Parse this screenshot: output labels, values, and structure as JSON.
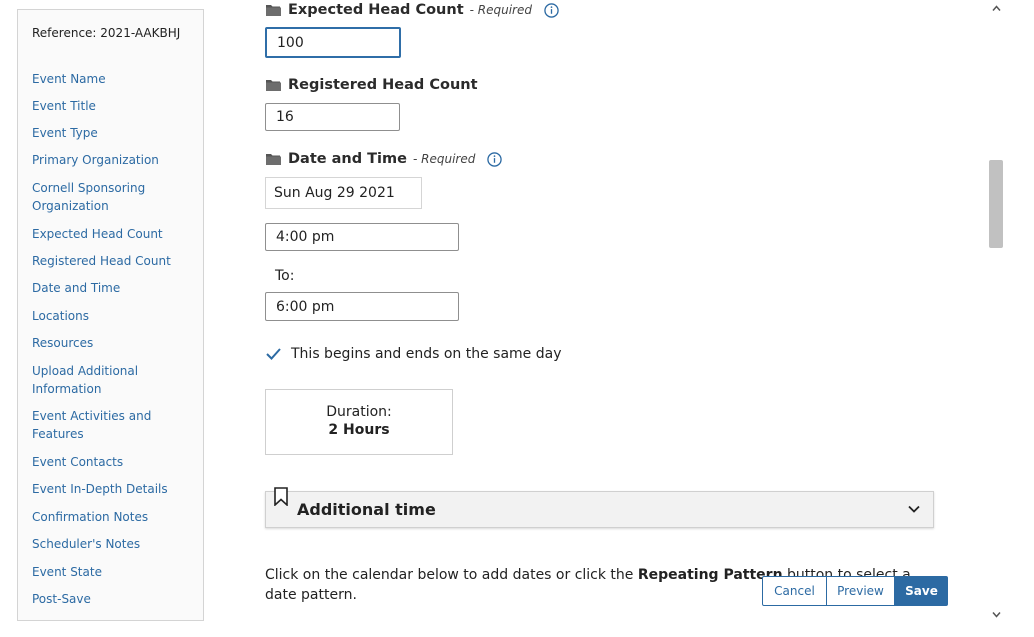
{
  "sidebar": {
    "reference": "Reference: 2021-AAKBHJ",
    "items": [
      "Event Name",
      "Event Title",
      "Event Type",
      "Primary Organization",
      "Cornell Sponsoring Organization",
      "Expected Head Count",
      "Registered Head Count",
      "Date and Time",
      "Locations",
      "Resources",
      "Upload Additional Information",
      "Event Activities and Features",
      "Event Contacts",
      "Event In-Depth Details",
      "Confirmation Notes",
      "Scheduler's Notes",
      "Event State",
      "Post-Save"
    ]
  },
  "expected": {
    "label": "Expected Head Count",
    "required": "- Required",
    "value": "100"
  },
  "registered": {
    "label": "Registered Head Count",
    "value": "16"
  },
  "datetime": {
    "label": "Date and Time",
    "required": "- Required",
    "date": "Sun Aug 29 2021",
    "start": "4:00 pm",
    "to_label": "To:",
    "end": "6:00 pm",
    "same_day_label": "This begins and ends on the same day",
    "same_day_checked": true
  },
  "duration": {
    "label": "Duration:",
    "value": "2 Hours"
  },
  "additional_time": {
    "title": "Additional time"
  },
  "instructions": {
    "part1": "Click on the calendar below to add dates or click the ",
    "bold": "Repeating Pattern",
    "part2": " button to select a date pattern."
  },
  "buttons": {
    "cancel": "Cancel",
    "preview": "Preview",
    "save": "Save"
  },
  "colors": {
    "accent": "#2c6aa3",
    "focus_border": "#2f6ea8"
  }
}
